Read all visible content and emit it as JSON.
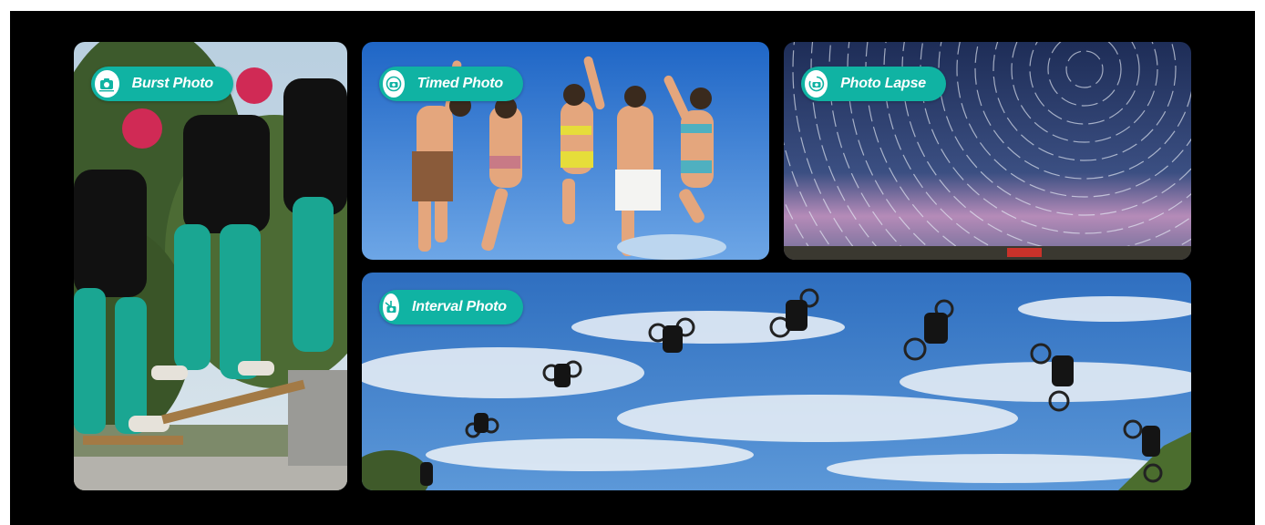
{
  "modes": {
    "burst": {
      "label": "Burst Photo",
      "icon": "burst-camera-icon"
    },
    "timed": {
      "label": "Timed Photo",
      "icon": "timer-camera-icon"
    },
    "lapse": {
      "label": "Photo Lapse",
      "icon": "lapse-camera-icon"
    },
    "interval": {
      "label": "Interval Photo",
      "icon": "interval-camera-icon"
    }
  },
  "colors": {
    "badge": "#10b3a3",
    "background": "#000000",
    "border": "#ffffff"
  }
}
